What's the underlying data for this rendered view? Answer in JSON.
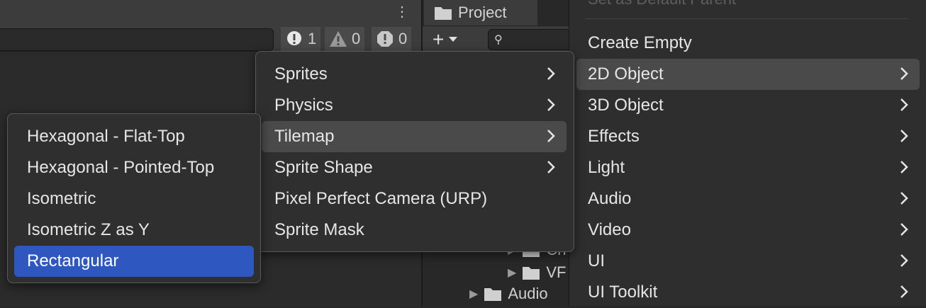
{
  "console": {
    "counters": [
      {
        "icon": "info-icon",
        "count": "1"
      },
      {
        "icon": "warning-icon",
        "count": "0"
      },
      {
        "icon": "error-icon",
        "count": "0"
      }
    ]
  },
  "project": {
    "tab_label": "Project",
    "tree": [
      {
        "label": "Ch",
        "indent": 2
      },
      {
        "label": "VF",
        "indent": 2
      },
      {
        "label": "Audio",
        "indent": 1
      }
    ]
  },
  "create_menu": {
    "faded_label": "Set as Default Parent",
    "items": [
      {
        "label": "Create Empty",
        "submenu": false
      },
      {
        "label": "2D Object",
        "submenu": true
      },
      {
        "label": "3D Object",
        "submenu": true
      },
      {
        "label": "Effects",
        "submenu": true
      },
      {
        "label": "Light",
        "submenu": true
      },
      {
        "label": "Audio",
        "submenu": true
      },
      {
        "label": "Video",
        "submenu": true
      },
      {
        "label": "UI",
        "submenu": true
      },
      {
        "label": "UI Toolkit",
        "submenu": true
      }
    ]
  },
  "submenu_2d": {
    "items": [
      {
        "label": "Sprites",
        "submenu": true
      },
      {
        "label": "Physics",
        "submenu": true
      },
      {
        "label": "Tilemap",
        "submenu": true
      },
      {
        "label": "Sprite Shape",
        "submenu": true
      },
      {
        "label": "Pixel Perfect Camera (URP)",
        "submenu": false
      },
      {
        "label": "Sprite Mask",
        "submenu": false
      }
    ]
  },
  "submenu_tilemap": {
    "items": [
      {
        "label": "Hexagonal - Flat-Top"
      },
      {
        "label": "Hexagonal - Pointed-Top"
      },
      {
        "label": "Isometric"
      },
      {
        "label": "Isometric Z as Y"
      },
      {
        "label": "Rectangular"
      }
    ]
  },
  "colors": {
    "selected_item": "#2e58c0",
    "hover_item": "#4a4a4a",
    "menu_bg": "#2e2e2e"
  }
}
